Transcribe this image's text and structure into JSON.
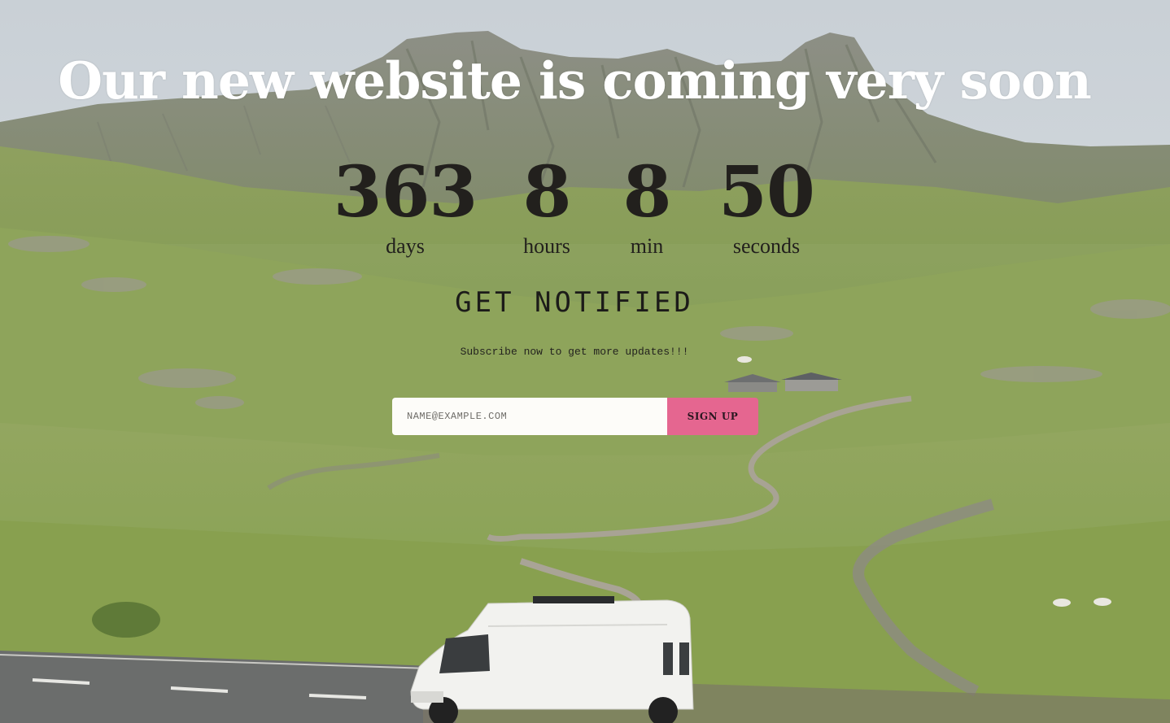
{
  "headline": "Our new website is coming very soon",
  "countdown": {
    "days": {
      "value": "363",
      "label": "days"
    },
    "hours": {
      "value": "8",
      "label": "hours"
    },
    "minutes": {
      "value": "8",
      "label": "min"
    },
    "seconds": {
      "value": "50",
      "label": "seconds"
    }
  },
  "notify": {
    "title": "GET NOTIFIED",
    "subtitle": "Subscribe now to get more updates!!!"
  },
  "form": {
    "email_placeholder": "NAME@EXAMPLE.COM",
    "email_value": "",
    "submit_label": "SIGN UP"
  },
  "colors": {
    "accent": "#e56690",
    "headline": "#ffffff",
    "text_dark": "#22201d",
    "input_bg": "#fdfcf9"
  }
}
